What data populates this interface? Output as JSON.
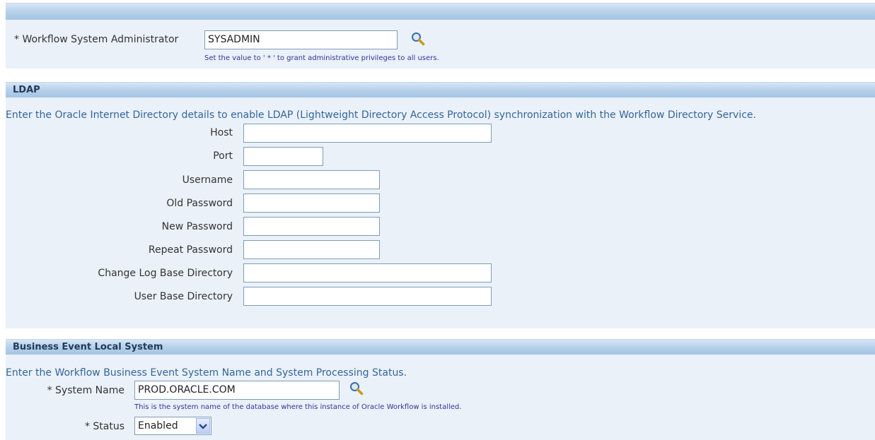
{
  "workflow_admin": {
    "label": "* Workflow System Administrator",
    "value": "SYSADMIN",
    "tip": "Set the value to ' * ' to grant administrative privileges to all users."
  },
  "ldap": {
    "header": "LDAP",
    "description": "Enter the Oracle Internet Directory details to enable LDAP (Lightweight Directory Access Protocol) synchronization with the Workflow Directory Service.",
    "fields": {
      "host": {
        "label": "Host",
        "value": ""
      },
      "port": {
        "label": "Port",
        "value": ""
      },
      "username": {
        "label": "Username",
        "value": ""
      },
      "old_password": {
        "label": "Old Password",
        "value": ""
      },
      "new_password": {
        "label": "New Password",
        "value": ""
      },
      "repeat_password": {
        "label": "Repeat Password",
        "value": ""
      },
      "change_log_base_directory": {
        "label": "Change Log Base Directory",
        "value": ""
      },
      "user_base_directory": {
        "label": "User Base Directory",
        "value": ""
      }
    }
  },
  "business_event": {
    "header": "Business Event Local System",
    "description": "Enter the Workflow Business Event System Name and System Processing Status.",
    "system_name": {
      "label": "* System Name",
      "value": "PROD.ORACLE.COM",
      "tip": "This is the system name of the database where this instance of Oracle Workflow is installed."
    },
    "status": {
      "label": "* Status",
      "selected": "Enabled"
    }
  },
  "icons": {
    "search": "search-icon",
    "dropdown": "chevron-down-icon"
  },
  "colors": {
    "header_bar": "#b3cfe9",
    "panel_bg": "#eaf1f9",
    "description_text": "#336699",
    "tip_text": "#333399"
  }
}
